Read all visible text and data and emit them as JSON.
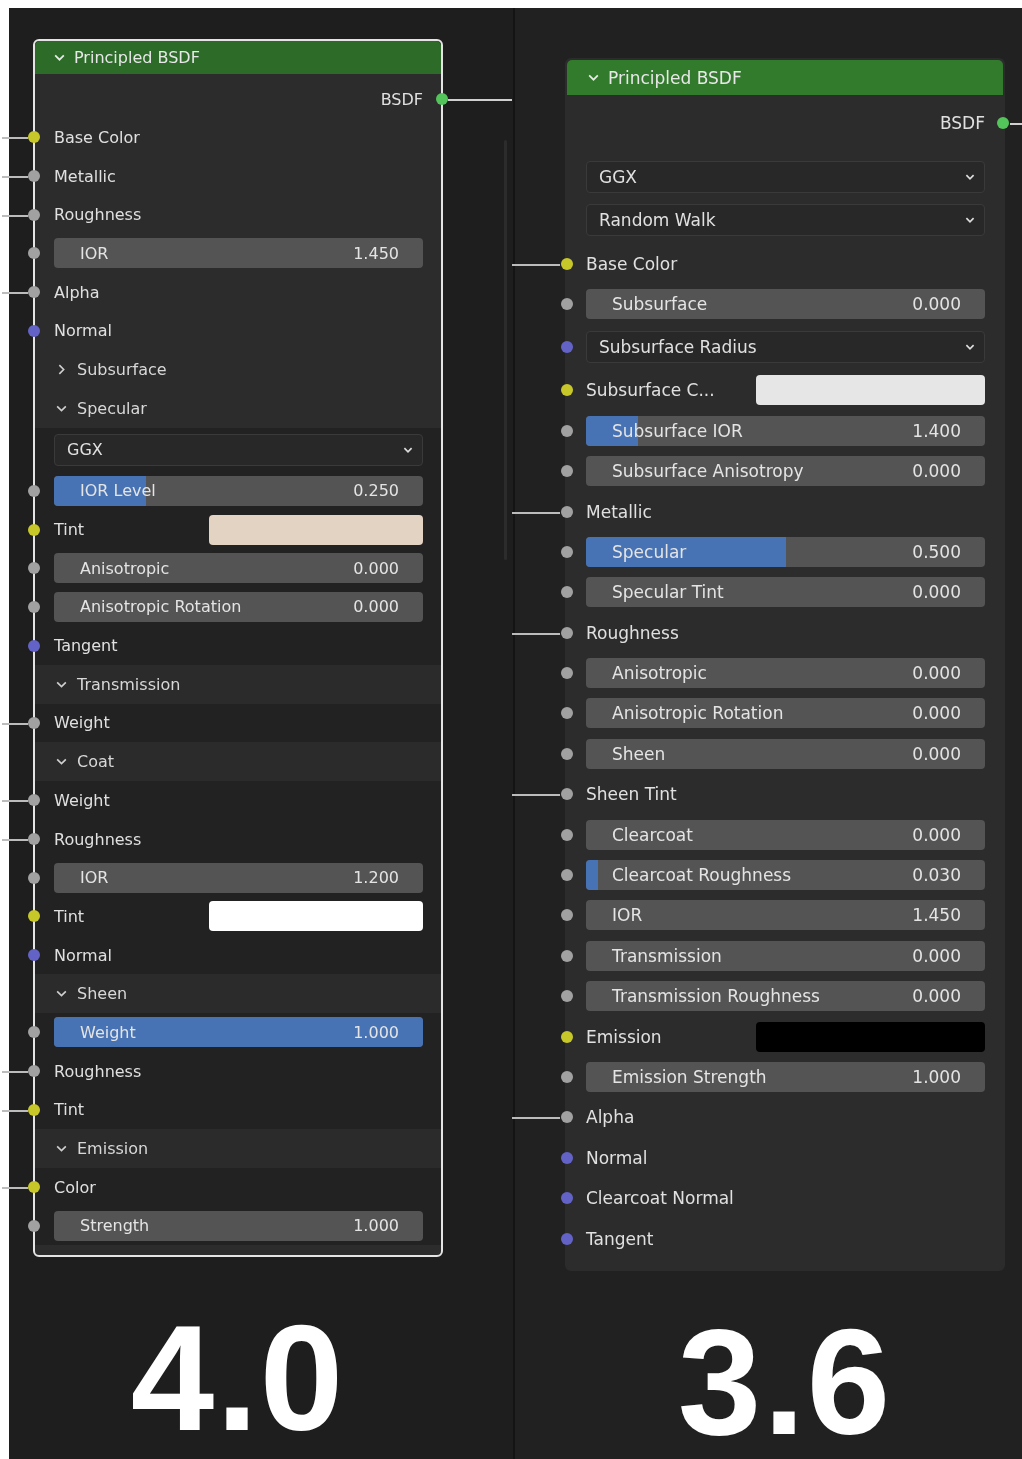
{
  "nodes": [
    {
      "title": "Principled BSDF",
      "expanded": true,
      "selected": true,
      "output": {
        "label": "BSDF",
        "color": "#52c45a",
        "linked": true
      },
      "rows": [
        {
          "kind": "input",
          "label": "Base Color",
          "color": "#c7c729",
          "linked": true
        },
        {
          "kind": "input",
          "label": "Metallic",
          "color": "#a1a1a1",
          "linked": true
        },
        {
          "kind": "input",
          "label": "Roughness",
          "color": "#a1a1a1",
          "linked": true
        },
        {
          "kind": "slider",
          "label": "IOR",
          "value": "1.450",
          "color": "#a1a1a1",
          "linked": false
        },
        {
          "kind": "input",
          "label": "Alpha",
          "color": "#a1a1a1",
          "linked": true
        },
        {
          "kind": "input",
          "label": "Normal",
          "color": "#6363c7",
          "linked": false
        },
        {
          "kind": "panel",
          "label": "Subsurface",
          "expanded": false
        },
        {
          "kind": "panel",
          "label": "Specular",
          "expanded": true
        },
        {
          "kind": "dropdown",
          "label": "GGX"
        },
        {
          "kind": "slider",
          "label": "IOR Level",
          "value": "0.250",
          "level": 0.25,
          "color": "#a1a1a1",
          "linked": false
        },
        {
          "kind": "color",
          "label": "Tint",
          "swatch": {
            "color": "#e3d3c3"
          },
          "color": "#c7c729",
          "linked": false
        },
        {
          "kind": "slider",
          "label": "Anisotropic",
          "value": "0.000",
          "color": "#a1a1a1",
          "linked": false
        },
        {
          "kind": "slider",
          "label": "Anisotropic Rotation",
          "value": "0.000",
          "color": "#a1a1a1",
          "linked": false
        },
        {
          "kind": "input",
          "label": "Tangent",
          "color": "#6363c7",
          "linked": false
        },
        {
          "kind": "panel",
          "label": "Transmission",
          "expanded": true
        },
        {
          "kind": "input",
          "label": "Weight",
          "color": "#a1a1a1",
          "linked": true
        },
        {
          "kind": "panel",
          "label": "Coat",
          "expanded": true
        },
        {
          "kind": "input",
          "label": "Weight",
          "color": "#a1a1a1",
          "linked": true
        },
        {
          "kind": "input",
          "label": "Roughness",
          "color": "#a1a1a1",
          "linked": true
        },
        {
          "kind": "slider",
          "label": "IOR",
          "value": "1.200",
          "color": "#a1a1a1",
          "linked": false
        },
        {
          "kind": "color",
          "label": "Tint",
          "swatch": {
            "color": "#ffffff"
          },
          "color": "#c7c729",
          "linked": false
        },
        {
          "kind": "input",
          "label": "Normal",
          "color": "#6363c7",
          "linked": false
        },
        {
          "kind": "panel",
          "label": "Sheen",
          "expanded": true
        },
        {
          "kind": "slider",
          "label": "Weight",
          "value": "1.000",
          "level": 1,
          "color": "#a1a1a1",
          "linked": false
        },
        {
          "kind": "input",
          "label": "Roughness",
          "color": "#a1a1a1",
          "linked": true
        },
        {
          "kind": "input",
          "label": "Tint",
          "color": "#c7c729",
          "linked": true
        },
        {
          "kind": "panel",
          "label": "Emission",
          "expanded": true
        },
        {
          "kind": "input",
          "label": "Color",
          "color": "#c7c729",
          "linked": true
        },
        {
          "kind": "slider",
          "label": "Strength",
          "value": "1.000",
          "color": "#a1a1a1",
          "linked": false
        }
      ],
      "version": "4.0"
    },
    {
      "title": "Principled BSDF",
      "expanded": true,
      "selected": false,
      "output": {
        "label": "BSDF",
        "color": "#52c45a",
        "linked": true
      },
      "rows": [
        {
          "kind": "dropdown",
          "label": "GGX"
        },
        {
          "kind": "dropdown",
          "label": "Random Walk"
        },
        {
          "kind": "input",
          "label": "Base Color",
          "color": "#c7c729",
          "linked": true
        },
        {
          "kind": "slider",
          "label": "Subsurface",
          "value": "0.000",
          "color": "#a1a1a1",
          "linked": false
        },
        {
          "kind": "dropdown",
          "label": "Subsurface Radius",
          "color": "#6363c7",
          "linked": false
        },
        {
          "kind": "color",
          "label": "Subsurface C...",
          "swatch": {
            "color": "#e6e6e6"
          },
          "color": "#c7c729",
          "linked": false
        },
        {
          "kind": "slider",
          "label": "Subsurface IOR",
          "value": "1.400",
          "level": 0.13,
          "color": "#a1a1a1",
          "linked": false
        },
        {
          "kind": "slider",
          "label": "Subsurface Anisotropy",
          "value": "0.000",
          "color": "#a1a1a1",
          "linked": false
        },
        {
          "kind": "input",
          "label": "Metallic",
          "color": "#a1a1a1",
          "linked": true
        },
        {
          "kind": "slider",
          "label": "Specular",
          "value": "0.500",
          "level": 0.5,
          "color": "#a1a1a1",
          "linked": false
        },
        {
          "kind": "slider",
          "label": "Specular Tint",
          "value": "0.000",
          "color": "#a1a1a1",
          "linked": false
        },
        {
          "kind": "input",
          "label": "Roughness",
          "color": "#a1a1a1",
          "linked": true
        },
        {
          "kind": "slider",
          "label": "Anisotropic",
          "value": "0.000",
          "color": "#a1a1a1",
          "linked": false
        },
        {
          "kind": "slider",
          "label": "Anisotropic Rotation",
          "value": "0.000",
          "color": "#a1a1a1",
          "linked": false
        },
        {
          "kind": "slider",
          "label": "Sheen",
          "value": "0.000",
          "color": "#a1a1a1",
          "linked": false
        },
        {
          "kind": "input",
          "label": "Sheen Tint",
          "color": "#a1a1a1",
          "linked": true
        },
        {
          "kind": "slider",
          "label": "Clearcoat",
          "value": "0.000",
          "color": "#a1a1a1",
          "linked": false
        },
        {
          "kind": "slider",
          "label": "Clearcoat Roughness",
          "value": "0.030",
          "level": 0.03,
          "color": "#a1a1a1",
          "linked": false
        },
        {
          "kind": "slider",
          "label": "IOR",
          "value": "1.450",
          "color": "#a1a1a1",
          "linked": false
        },
        {
          "kind": "slider",
          "label": "Transmission",
          "value": "0.000",
          "color": "#a1a1a1",
          "linked": false
        },
        {
          "kind": "slider",
          "label": "Transmission Roughness",
          "value": "0.000",
          "color": "#a1a1a1",
          "linked": false
        },
        {
          "kind": "color",
          "label": "Emission",
          "swatch": {
            "color": "#000000"
          },
          "color": "#c7c729",
          "linked": false
        },
        {
          "kind": "slider",
          "label": "Emission Strength",
          "value": "1.000",
          "color": "#a1a1a1",
          "linked": false
        },
        {
          "kind": "input",
          "label": "Alpha",
          "color": "#a1a1a1",
          "linked": true
        },
        {
          "kind": "input",
          "label": "Normal",
          "color": "#6363c7",
          "linked": false
        },
        {
          "kind": "input",
          "label": "Clearcoat Normal",
          "color": "#6363c7",
          "linked": false
        },
        {
          "kind": "input",
          "label": "Tangent",
          "color": "#6363c7",
          "linked": false
        }
      ],
      "version": "3.6"
    }
  ]
}
